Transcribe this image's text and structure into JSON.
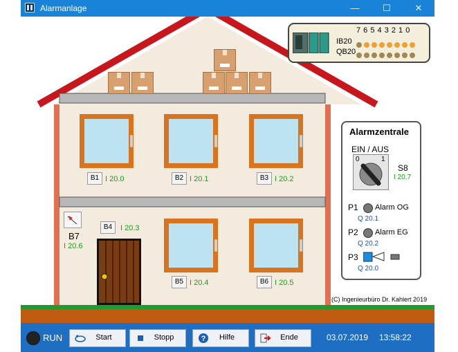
{
  "window": {
    "title": "Alarmanlage",
    "minimize": "—",
    "maximize": "☐",
    "close": "✕"
  },
  "plc": {
    "bits": "7 6 5 4 3 2 1 0",
    "row1_label": "IB20",
    "row2_label": "QB20",
    "led_on": "#f0a030",
    "led_off": "#a08850"
  },
  "sensors": [
    {
      "btn": "B1",
      "addr": "I 20.0"
    },
    {
      "btn": "B2",
      "addr": "I 20.1"
    },
    {
      "btn": "B3",
      "addr": "I 20.2"
    },
    {
      "btn": "B4",
      "addr": "I 20.3"
    },
    {
      "btn": "B5",
      "addr": "I 20.4"
    },
    {
      "btn": "B6",
      "addr": "I 20.5"
    }
  ],
  "b7": {
    "label": "B7",
    "addr": "I 20.6"
  },
  "zentrale": {
    "title": "Alarmzentrale",
    "switch_label": "EIN / AUS",
    "switch_off": "0",
    "switch_on": "1",
    "s8": "S8",
    "s8_addr": "I 20.7",
    "p1": "P1",
    "p1_text": "Alarm OG",
    "p1_addr": "Q 20.1",
    "p2": "P2",
    "p2_text": "Alarm EG",
    "p2_addr": "Q 20.2",
    "p3": "P3",
    "p3_addr": "Q 20.0"
  },
  "copyright": "(C) Ingenieurbüro Dr. Kahlert 2019",
  "toolbar": {
    "run": "RUN",
    "start": "Start",
    "stopp": "Stopp",
    "hilfe": "Hilfe",
    "ende": "Ende",
    "date": "03.07.2019",
    "time": "13:58:22"
  },
  "colors": {
    "titlebar": "#1883d7",
    "toolbar": "#1e6fc4",
    "wall": "#f3ebdd",
    "roof": "#c8161d",
    "window_frame": "#d9731e",
    "glass": "#bde3f2",
    "grass": "#1f9b2f",
    "ground": "#c25b12",
    "sensor_address": "#18a018",
    "output_address": "#2050b8"
  }
}
